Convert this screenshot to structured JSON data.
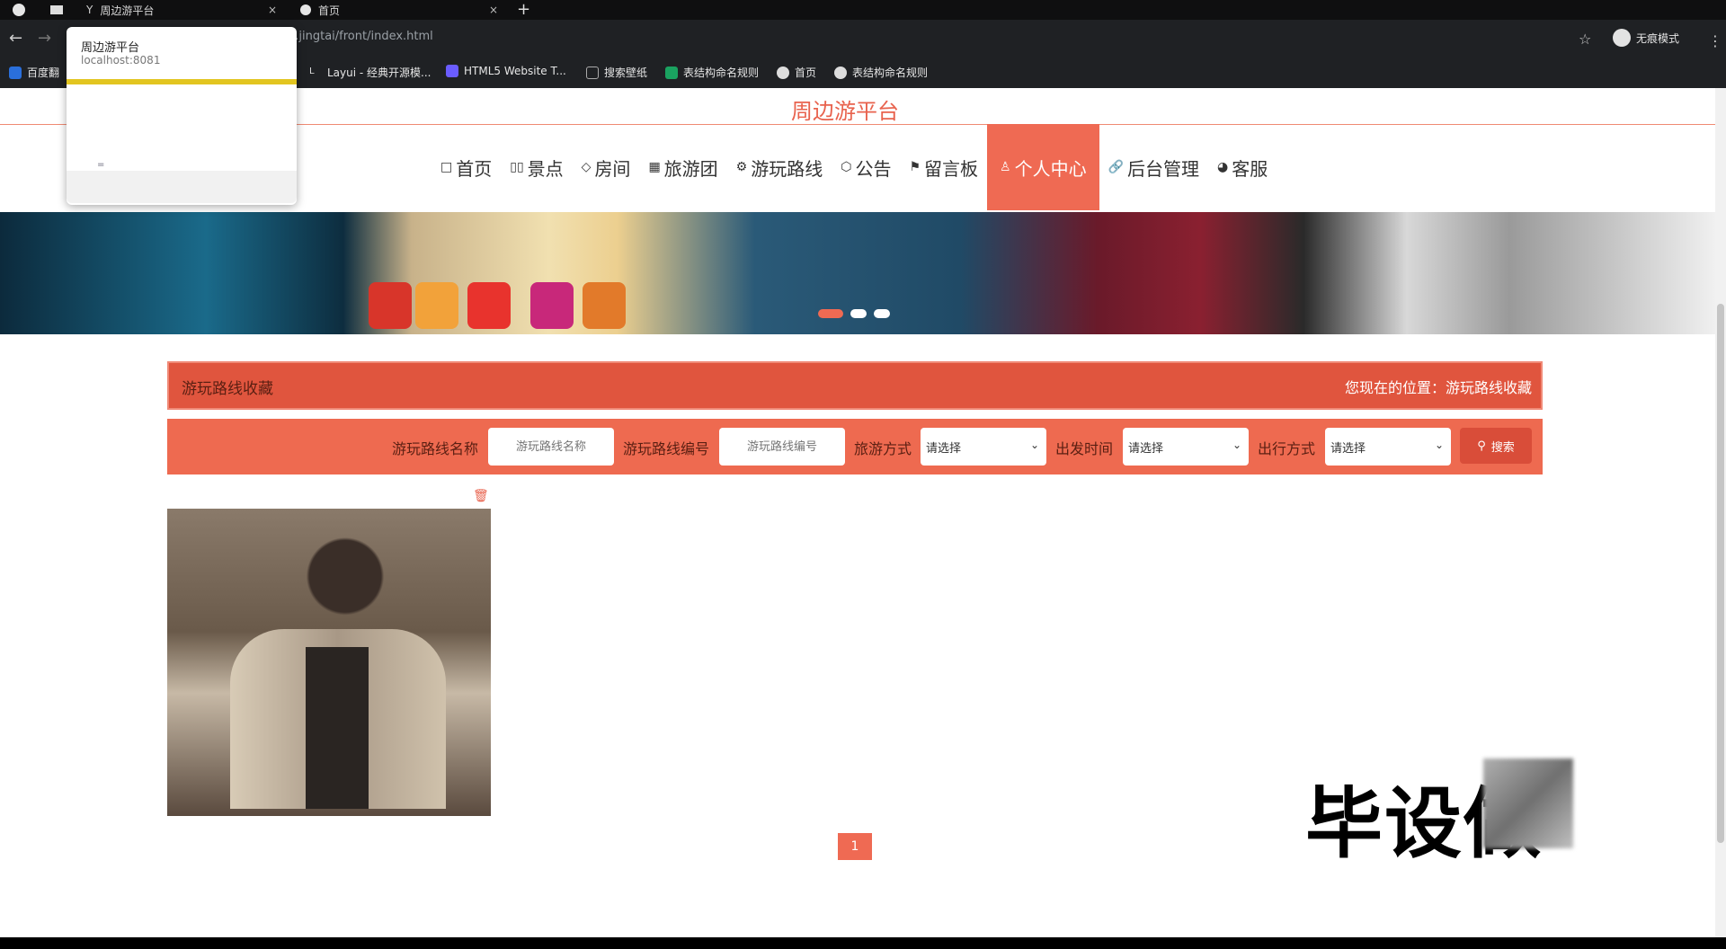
{
  "browser": {
    "tabs": [
      {
        "title": "周边游平台",
        "close": "×"
      },
      {
        "title": "首页",
        "close": "×"
      }
    ],
    "new_tab": "+",
    "address": "...jingtai/front/index.html",
    "incognito_label": "无痕模式",
    "bookmarks": [
      "百度翻",
      "Layui - 经典开源模...",
      "HTML5 Website T...",
      "搜索壁纸",
      "表结构命名规则",
      "首页",
      "表结构命名规则"
    ]
  },
  "popup": {
    "title": "周边游平台",
    "url": "localhost:8081",
    "mini": "="
  },
  "site": {
    "title": "周边游平台",
    "nav": [
      {
        "icon": "□",
        "label": "首页"
      },
      {
        "icon": "▯▯",
        "label": "景点"
      },
      {
        "icon": "◇",
        "label": "房间"
      },
      {
        "icon": "▦",
        "label": "旅游团"
      },
      {
        "icon": "⚙",
        "label": "游玩路线"
      },
      {
        "icon": "⬡",
        "label": "公告"
      },
      {
        "icon": "⚑",
        "label": "留言板"
      },
      {
        "icon": "♙",
        "label": "个人中心"
      },
      {
        "icon": "🔗",
        "label": "后台管理"
      },
      {
        "icon": "◕",
        "label": "客服"
      }
    ],
    "active_nav": "个人中心",
    "breadcrumb": {
      "page": "游玩路线收藏",
      "prefix": "您现在的位置：",
      "current": "游玩路线收藏"
    },
    "search": {
      "route_name_label": "游玩路线名称",
      "route_name_placeholder": "游玩路线名称",
      "route_no_label": "游玩路线编号",
      "route_no_placeholder": "游玩路线编号",
      "travel_mode_label": "旅游方式",
      "travel_mode_value": "请选择",
      "depart_time_label": "出发时间",
      "depart_time_value": "请选择",
      "trip_mode_label": "出行方式",
      "trip_mode_value": "请选择",
      "search_button": "搜索"
    },
    "pagination": {
      "current": "1"
    },
    "watermark": "毕设做"
  },
  "colors": {
    "accent": "#ef6a53",
    "accent_dark": "#e0553e",
    "title": "#e8624d"
  }
}
